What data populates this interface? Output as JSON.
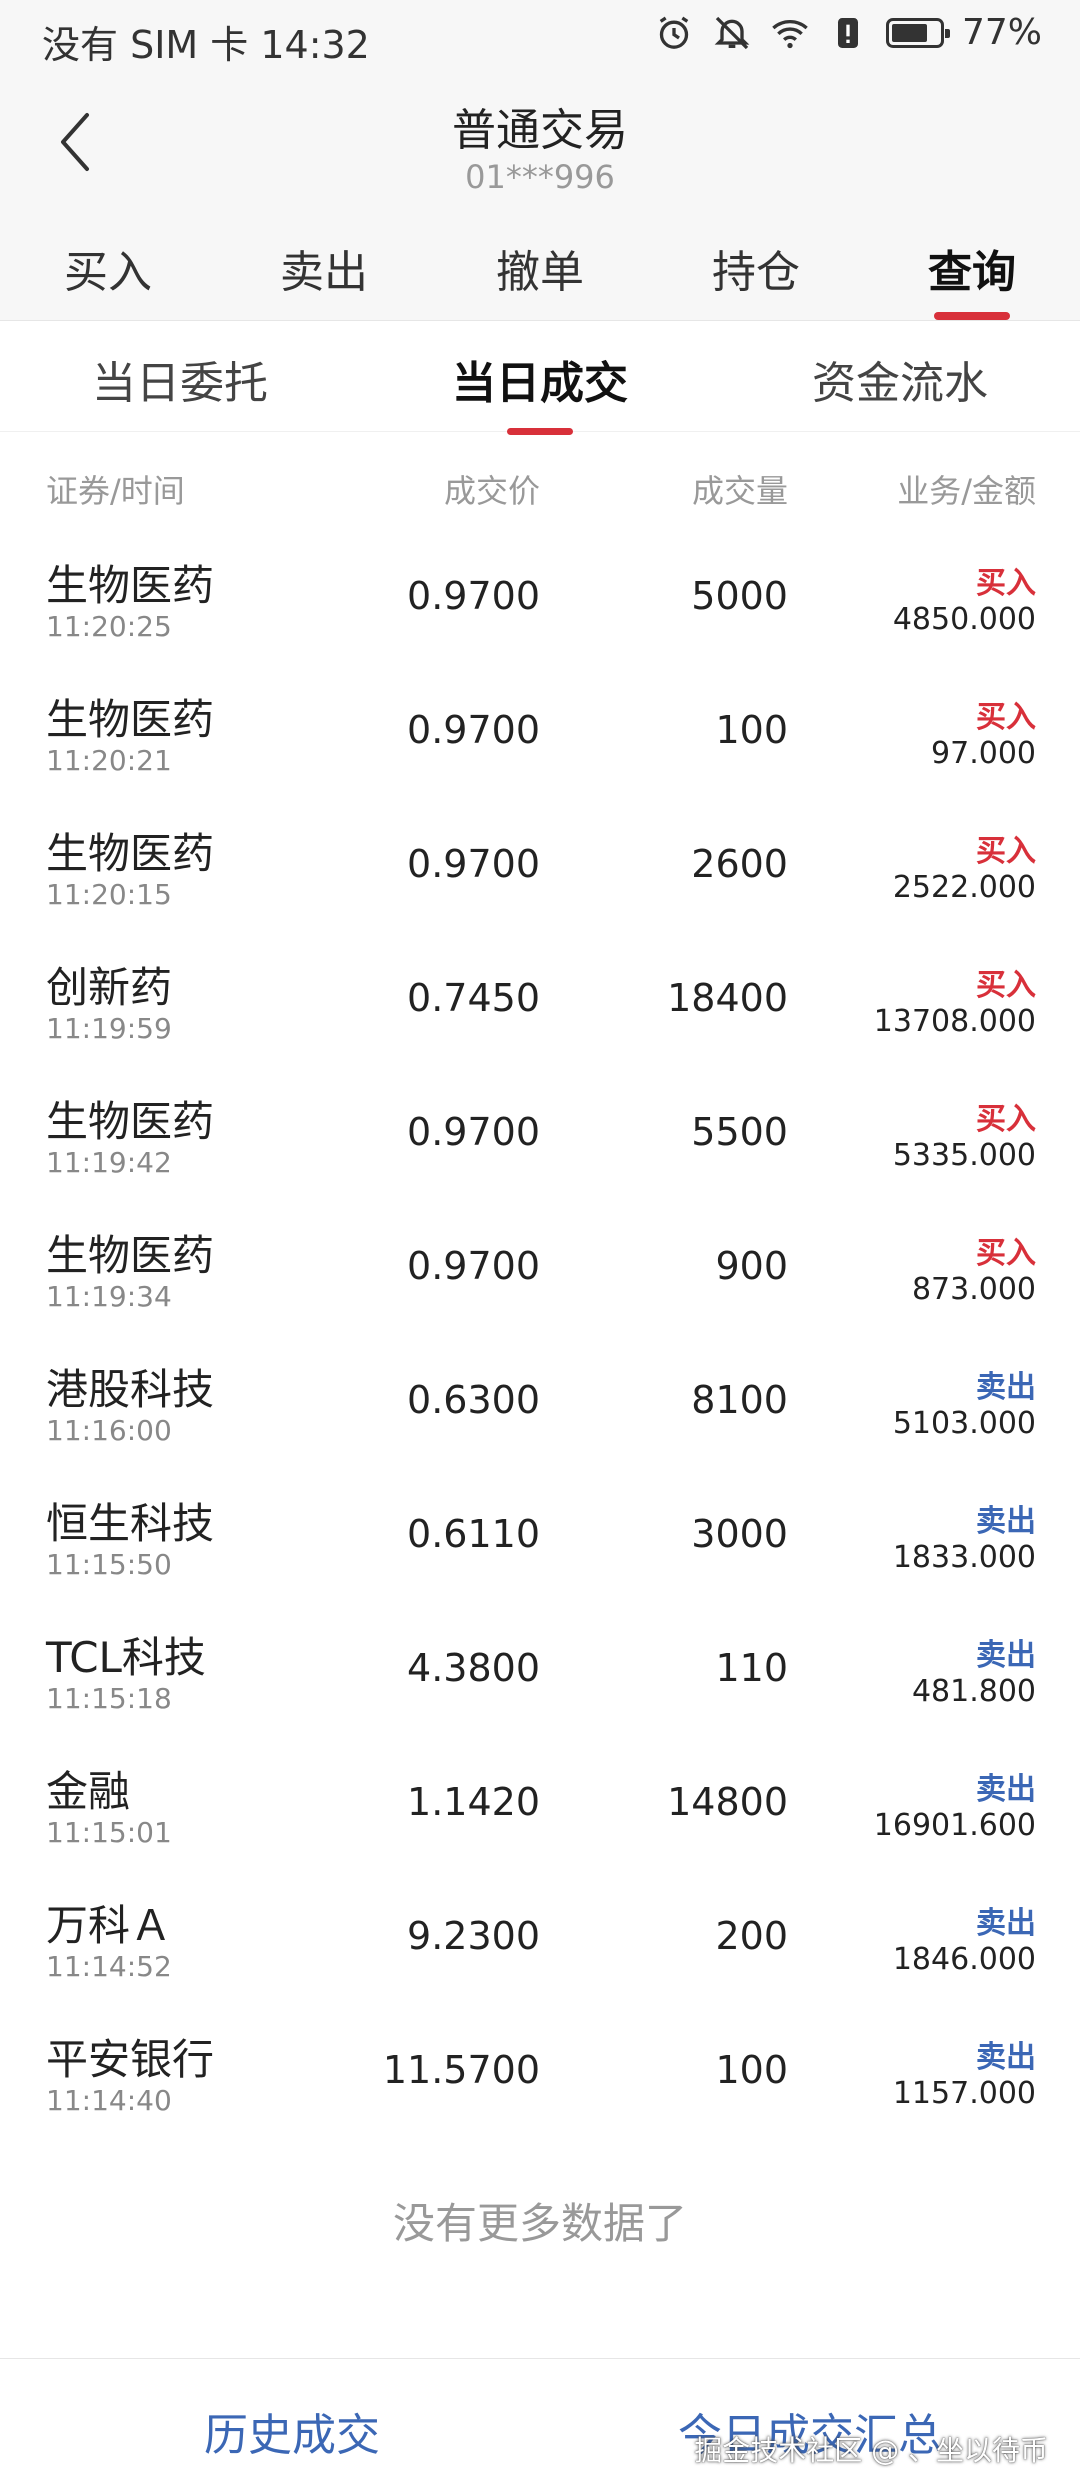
{
  "status_bar": {
    "left_text": "没有 SIM 卡 14:32",
    "battery_percent": "77%",
    "battery_level": 0.77,
    "icons": [
      "alarm-icon",
      "mute-icon",
      "wifi-icon",
      "alert-icon",
      "battery-icon"
    ]
  },
  "header": {
    "title": "普通交易",
    "account": "01***996",
    "back_icon": "chevron-left-icon"
  },
  "main_tabs": [
    "买入",
    "卖出",
    "撤单",
    "持仓",
    "查询"
  ],
  "main_tab_active": "查询",
  "sub_tabs": [
    "当日委托",
    "当日成交",
    "资金流水"
  ],
  "sub_tab_active": "当日成交",
  "columns": {
    "security_time": "证券/时间",
    "price": "成交价",
    "qty": "成交量",
    "type_amount": "业务/金额"
  },
  "colors": {
    "buy": "#d8303a",
    "sell": "#3b67b5",
    "accent": "#d8303a"
  },
  "trades": [
    {
      "name": "生物医药",
      "time": "11:20:25",
      "price": "0.9700",
      "qty": "5000",
      "type": "买入",
      "amount": "4850.000",
      "side": "buy"
    },
    {
      "name": "生物医药",
      "time": "11:20:21",
      "price": "0.9700",
      "qty": "100",
      "type": "买入",
      "amount": "97.000",
      "side": "buy"
    },
    {
      "name": "生物医药",
      "time": "11:20:15",
      "price": "0.9700",
      "qty": "2600",
      "type": "买入",
      "amount": "2522.000",
      "side": "buy"
    },
    {
      "name": "创新药",
      "time": "11:19:59",
      "price": "0.7450",
      "qty": "18400",
      "type": "买入",
      "amount": "13708.000",
      "side": "buy"
    },
    {
      "name": "生物医药",
      "time": "11:19:42",
      "price": "0.9700",
      "qty": "5500",
      "type": "买入",
      "amount": "5335.000",
      "side": "buy"
    },
    {
      "name": "生物医药",
      "time": "11:19:34",
      "price": "0.9700",
      "qty": "900",
      "type": "买入",
      "amount": "873.000",
      "side": "buy"
    },
    {
      "name": "港股科技",
      "time": "11:16:00",
      "price": "0.6300",
      "qty": "8100",
      "type": "卖出",
      "amount": "5103.000",
      "side": "sell"
    },
    {
      "name": "恒生科技",
      "time": "11:15:50",
      "price": "0.6110",
      "qty": "3000",
      "type": "卖出",
      "amount": "1833.000",
      "side": "sell"
    },
    {
      "name": "TCL科技",
      "time": "11:15:18",
      "price": "4.3800",
      "qty": "110",
      "type": "卖出",
      "amount": "481.800",
      "side": "sell"
    },
    {
      "name": "金融",
      "time": "11:15:01",
      "price": "1.1420",
      "qty": "14800",
      "type": "卖出",
      "amount": "16901.600",
      "side": "sell"
    },
    {
      "name": "万科Ａ",
      "time": "11:14:52",
      "price": "9.2300",
      "qty": "200",
      "type": "卖出",
      "amount": "1846.000",
      "side": "sell"
    },
    {
      "name": "平安银行",
      "time": "11:14:40",
      "price": "11.5700",
      "qty": "100",
      "type": "卖出",
      "amount": "1157.000",
      "side": "sell"
    }
  ],
  "no_more_text": "没有更多数据了",
  "bottom": {
    "history_label": "历史成交",
    "summary_label": "今日成交汇总",
    "watermark": "掘金技术社区 @ 、坐以待币"
  }
}
